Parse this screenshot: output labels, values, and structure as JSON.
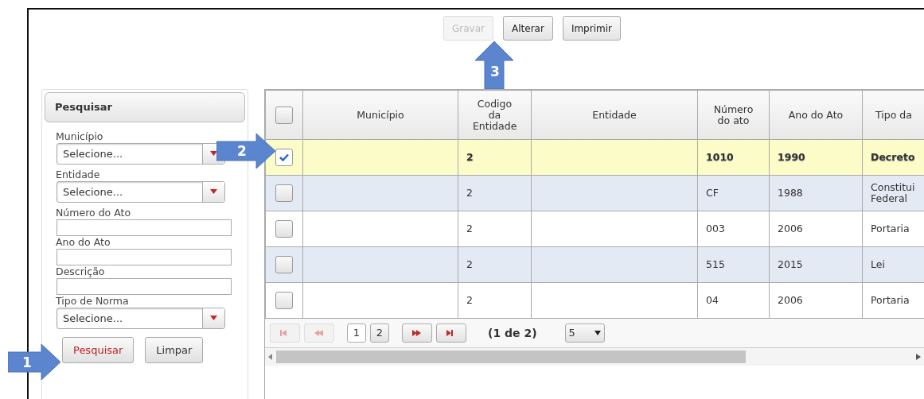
{
  "toolbar": [
    {
      "label": "Gravar",
      "disabled": true
    },
    {
      "label": "Alterar",
      "disabled": false
    },
    {
      "label": "Imprimir",
      "disabled": false
    }
  ],
  "search_panel": {
    "title": "Pesquisar",
    "fields": [
      {
        "kind": "select",
        "label": "Município",
        "value": "Selecione..."
      },
      {
        "kind": "select",
        "label": "Entidade",
        "value": "Selecione..."
      },
      {
        "kind": "text",
        "label": "Número do Ato"
      },
      {
        "kind": "text",
        "label": "Ano do Ato"
      },
      {
        "kind": "text",
        "label": "Descrição"
      },
      {
        "kind": "select",
        "label": "Tipo de Norma",
        "value": "Selecione..."
      }
    ],
    "buttons": [
      {
        "label": "Pesquisar",
        "kind": "primary"
      },
      {
        "label": "Limpar",
        "kind": "plain"
      }
    ]
  },
  "table": {
    "select_all_checked": false,
    "columns": [
      "Município",
      "Codigo da Entidade",
      "Entidade",
      "Número do ato",
      "Ano do Ato",
      "Tipo da"
    ],
    "rows": [
      {
        "selected": true,
        "codigo_da_entidade": "2",
        "numero_do_ato": "1010",
        "ano_do_ato": "1990",
        "tipo": "Decreto"
      },
      {
        "selected": false,
        "codigo_da_entidade": "2",
        "numero_do_ato": "CF",
        "ano_do_ato": "1988",
        "tipo": "Constitui Federal"
      },
      {
        "selected": false,
        "codigo_da_entidade": "2",
        "numero_do_ato": "003",
        "ano_do_ato": "2006",
        "tipo": "Portaria"
      },
      {
        "selected": false,
        "codigo_da_entidade": "2",
        "numero_do_ato": "515",
        "ano_do_ato": "2015",
        "tipo": "Lei"
      },
      {
        "selected": false,
        "codigo_da_entidade": "2",
        "numero_do_ato": "04",
        "ano_do_ato": "2006",
        "tipo": "Portaria"
      }
    ],
    "paginator": {
      "pages": [
        {
          "label": "1",
          "selected": true
        },
        {
          "label": "2",
          "selected": false
        }
      ],
      "report": "(1 de 2)",
      "rows_per_page": "5"
    }
  },
  "annotations": [
    {
      "label": "1",
      "kind": "right"
    },
    {
      "label": "2",
      "kind": "right"
    },
    {
      "label": "3",
      "kind": "up"
    }
  ]
}
